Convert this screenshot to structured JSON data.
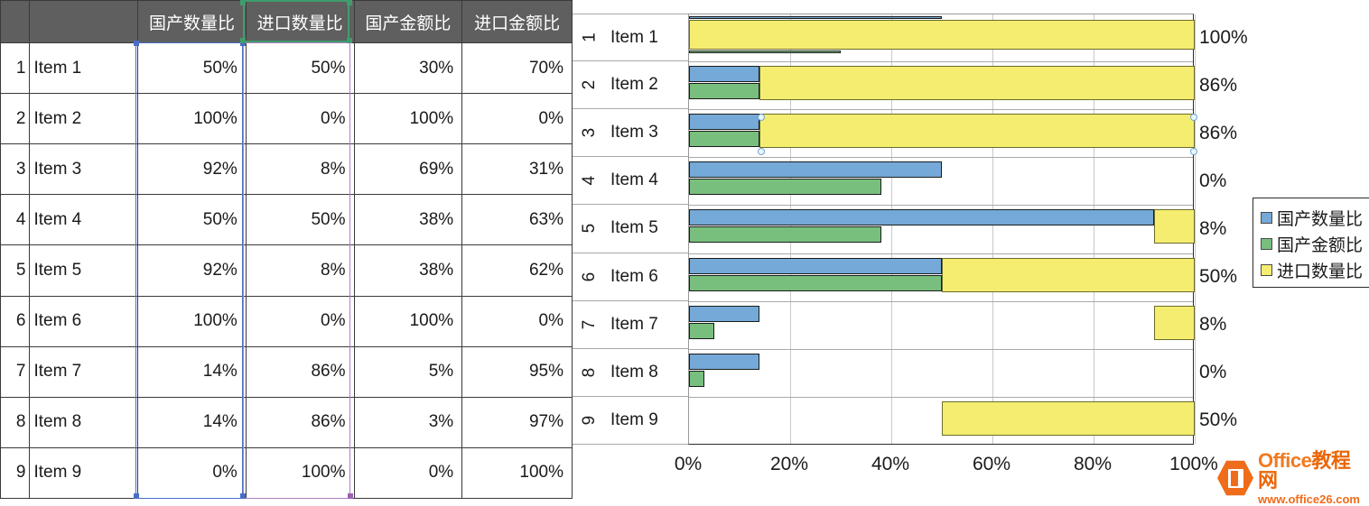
{
  "spreadsheet": {
    "headers": [
      "",
      "",
      "国产数量比",
      "进口数量比",
      "国产金额比",
      "进口金额比"
    ],
    "rows": [
      {
        "num": "1",
        "name": "Item 1",
        "v": [
          "50%",
          "50%",
          "30%",
          "70%"
        ]
      },
      {
        "num": "2",
        "name": "Item 2",
        "v": [
          "100%",
          "0%",
          "100%",
          "0%"
        ]
      },
      {
        "num": "3",
        "name": "Item 3",
        "v": [
          "92%",
          "8%",
          "69%",
          "31%"
        ]
      },
      {
        "num": "4",
        "name": "Item 4",
        "v": [
          "50%",
          "50%",
          "38%",
          "63%"
        ]
      },
      {
        "num": "5",
        "name": "Item 5",
        "v": [
          "92%",
          "8%",
          "38%",
          "62%"
        ]
      },
      {
        "num": "6",
        "name": "Item 6",
        "v": [
          "100%",
          "0%",
          "100%",
          "0%"
        ]
      },
      {
        "num": "7",
        "name": "Item 7",
        "v": [
          "14%",
          "86%",
          "5%",
          "95%"
        ]
      },
      {
        "num": "8",
        "name": "Item 8",
        "v": [
          "14%",
          "86%",
          "3%",
          "97%"
        ]
      },
      {
        "num": "9",
        "name": "Item 9",
        "v": [
          "0%",
          "100%",
          "0%",
          "100%"
        ]
      }
    ]
  },
  "chart_data": {
    "type": "bar",
    "orientation": "horizontal",
    "title": "",
    "xlabel": "",
    "ylabel": "",
    "xlim": [
      0,
      100
    ],
    "grid": true,
    "legend_position": "right",
    "categories": [
      "Item 1",
      "Item 2",
      "Item 3",
      "Item 4",
      "Item 5",
      "Item 6",
      "Item 7",
      "Item 8",
      "Item 9"
    ],
    "category_numbers": [
      "1",
      "2",
      "3",
      "4",
      "5",
      "6",
      "7",
      "8",
      "9"
    ],
    "xticks": [
      "0%",
      "20%",
      "40%",
      "60%",
      "80%",
      "100%"
    ],
    "xtick_values": [
      0,
      20,
      40,
      60,
      80,
      100
    ],
    "series": [
      {
        "name": "国产数量比",
        "color": "#74a9d8",
        "values": [
          50,
          14,
          14,
          50,
          92,
          50,
          14,
          14,
          0
        ]
      },
      {
        "name": "国产金额比",
        "color": "#78bf7e",
        "values": [
          30,
          14,
          14,
          38,
          38,
          50,
          5,
          3,
          0
        ]
      },
      {
        "name": "进口数量比",
        "color": "#f5ed70",
        "values": [
          100,
          86,
          86,
          0,
          8,
          50,
          8,
          0,
          50
        ]
      }
    ],
    "value_labels": [
      "100%",
      "86%",
      "86%",
      "0%",
      "8%",
      "50%",
      "8%",
      "0%",
      "50%"
    ],
    "bar_layout": [
      {
        "cat": "Item 1",
        "blue": {
          "x": 0,
          "w": 50,
          "t": 2,
          "h": 3
        },
        "green": {
          "x": 0,
          "w": 30,
          "t": 40,
          "h": 3
        },
        "yellow": {
          "x": 0,
          "w": 100,
          "t": 6,
          "h": 33
        }
      },
      {
        "cat": "Item 2",
        "blue": {
          "x": 0,
          "w": 14,
          "t": 4,
          "h": 18
        },
        "green": {
          "x": 0,
          "w": 14,
          "t": 23,
          "h": 18
        },
        "yellow": {
          "x": 14,
          "w": 86,
          "t": 4,
          "h": 38
        }
      },
      {
        "cat": "Item 3",
        "blue": {
          "x": 0,
          "w": 14,
          "t": 4,
          "h": 18
        },
        "green": {
          "x": 0,
          "w": 14,
          "t": 23,
          "h": 18
        },
        "yellow": {
          "x": 14,
          "w": 86,
          "t": 4,
          "h": 38
        }
      },
      {
        "cat": "Item 4",
        "blue": {
          "x": 0,
          "w": 50,
          "t": 4,
          "h": 18
        },
        "green": {
          "x": 0,
          "w": 38,
          "t": 23,
          "h": 18
        },
        "yellow": null
      },
      {
        "cat": "Item 5",
        "blue": {
          "x": 0,
          "w": 92,
          "t": 4,
          "h": 18
        },
        "green": {
          "x": 0,
          "w": 38,
          "t": 23,
          "h": 18
        },
        "yellow": {
          "x": 92,
          "w": 8,
          "t": 4,
          "h": 38
        }
      },
      {
        "cat": "Item 6",
        "blue": {
          "x": 0,
          "w": 50,
          "t": 4,
          "h": 18
        },
        "green": {
          "x": 0,
          "w": 50,
          "t": 23,
          "h": 18
        },
        "yellow": {
          "x": 50,
          "w": 50,
          "t": 4,
          "h": 38
        }
      },
      {
        "cat": "Item 7",
        "blue": {
          "x": 0,
          "w": 14,
          "t": 4,
          "h": 18
        },
        "green": {
          "x": 0,
          "w": 5,
          "t": 23,
          "h": 18
        },
        "yellow": {
          "x": 92,
          "w": 8,
          "t": 4,
          "h": 38
        }
      },
      {
        "cat": "Item 8",
        "blue": {
          "x": 0,
          "w": 14,
          "t": 4,
          "h": 18
        },
        "green": {
          "x": 0,
          "w": 3,
          "t": 23,
          "h": 18
        },
        "yellow": null
      },
      {
        "cat": "Item 9",
        "blue": null,
        "green": null,
        "yellow": {
          "x": 50,
          "w": 50,
          "t": 4,
          "h": 38
        }
      }
    ]
  },
  "legend": {
    "items": [
      {
        "label": "国产数量比",
        "color": "#74a9d8"
      },
      {
        "label": "国产金额比",
        "color": "#78bf7e"
      },
      {
        "label": "进口数量比",
        "color": "#f5ed70"
      }
    ]
  },
  "watermark": {
    "title": "Office",
    "title_cn": "教程网",
    "url": "www.office26.com"
  },
  "colors": {
    "series_blue": "#74a9d8",
    "series_green": "#78bf7e",
    "series_yellow": "#f5ed70",
    "header_bg": "#5f5f5f",
    "sel_blue": "#4a6ec8",
    "sel_green": "#3f9d6d",
    "sel_purple": "#b07fc4",
    "brand_orange": "#ef6c1a"
  }
}
